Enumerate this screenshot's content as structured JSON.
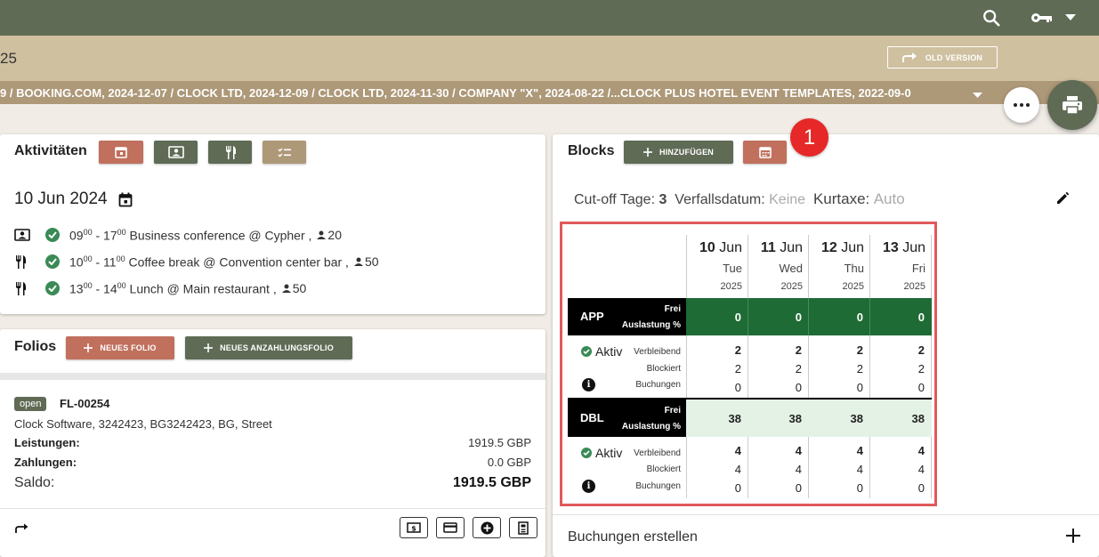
{
  "header": {
    "subtitle": "25",
    "old_version_label": "OLD VERSION",
    "breadcrumb": "9  /  BOOKING.COM, 2024-12-07  /  CLOCK LTD, 2024-12-09  /  CLOCK LTD, 2024-11-30  /  COMPANY \"X\", 2024-08-22  /...CLOCK PLUS HOTEL EVENT TEMPLATES, 2022-09-0"
  },
  "colors": {
    "primary": "#5f6b55",
    "accent_red": "#c0705d",
    "tan": "#ad9878",
    "band_green": "#1e6b35",
    "band_light": "#e4f2e6"
  },
  "activities": {
    "title": "Aktivitäten",
    "date": "10 Jun 2024",
    "items": [
      {
        "icon": "person-card-icon",
        "start": "09",
        "end": "17",
        "text": "Business conference @ Cypher ,",
        "count": "20"
      },
      {
        "icon": "cutlery-icon",
        "start": "10",
        "end": "11",
        "text": "Coffee break @ Convention center bar ,",
        "count": "50"
      },
      {
        "icon": "cutlery-icon",
        "start": "13",
        "end": "14",
        "text": "Lunch @ Main restaurant ,",
        "count": "50"
      }
    ],
    "sup": "00"
  },
  "folios": {
    "title": "Folios",
    "new_folio": "NEUES FOLIO",
    "new_deposit": "NEUES ANZAHLUNGSFOLIO",
    "status": "open",
    "id": "FL-00254",
    "address": "Clock Software, 3242423, BG3242423, BG, Street",
    "services_label": "Leistungen:",
    "services_value": "1919.5 GBP",
    "payments_label": "Zahlungen:",
    "payments_value": "0.0 GBP",
    "balance_label": "Saldo:",
    "balance_value": "1919.5 GBP"
  },
  "blocks": {
    "title": "Blocks",
    "add_label": "HINZUFÜGEN",
    "marker": "1",
    "cutoff_label": "Cut-off Tage:",
    "cutoff_value": "3",
    "expiry_label": "Verfallsdatum:",
    "expiry_value": "Keine",
    "tax_label": "Kurtaxe:",
    "tax_value": "Auto",
    "days": [
      {
        "day": "10",
        "month": "Jun",
        "weekday": "Tue",
        "year": "2025"
      },
      {
        "day": "11",
        "month": "Jun",
        "weekday": "Wed",
        "year": "2025"
      },
      {
        "day": "12",
        "month": "Jun",
        "weekday": "Thu",
        "year": "2025"
      },
      {
        "day": "13",
        "month": "Jun",
        "weekday": "Fri",
        "year": "2025"
      }
    ],
    "labels": {
      "free": "Frei",
      "occupancy": "Auslastung %",
      "active": "Aktiv",
      "remaining": "Verbleibend",
      "blocked": "Blockiert",
      "bookings": "Buchungen",
      "info": "i"
    },
    "rooms": [
      {
        "code": "APP",
        "band": [
          "0",
          "0",
          "0",
          "0"
        ],
        "remaining": [
          "2",
          "2",
          "2",
          "2"
        ],
        "blocked": [
          "2",
          "2",
          "2",
          "2"
        ],
        "bookings": [
          "0",
          "0",
          "0",
          "0"
        ]
      },
      {
        "code": "DBL",
        "band": [
          "38",
          "38",
          "38",
          "38"
        ],
        "remaining": [
          "4",
          "4",
          "4",
          "4"
        ],
        "blocked": [
          "4",
          "4",
          "4",
          "4"
        ],
        "bookings": [
          "0",
          "0",
          "0",
          "0"
        ]
      }
    ]
  },
  "bookings": {
    "title": "Buchungen erstellen"
  }
}
